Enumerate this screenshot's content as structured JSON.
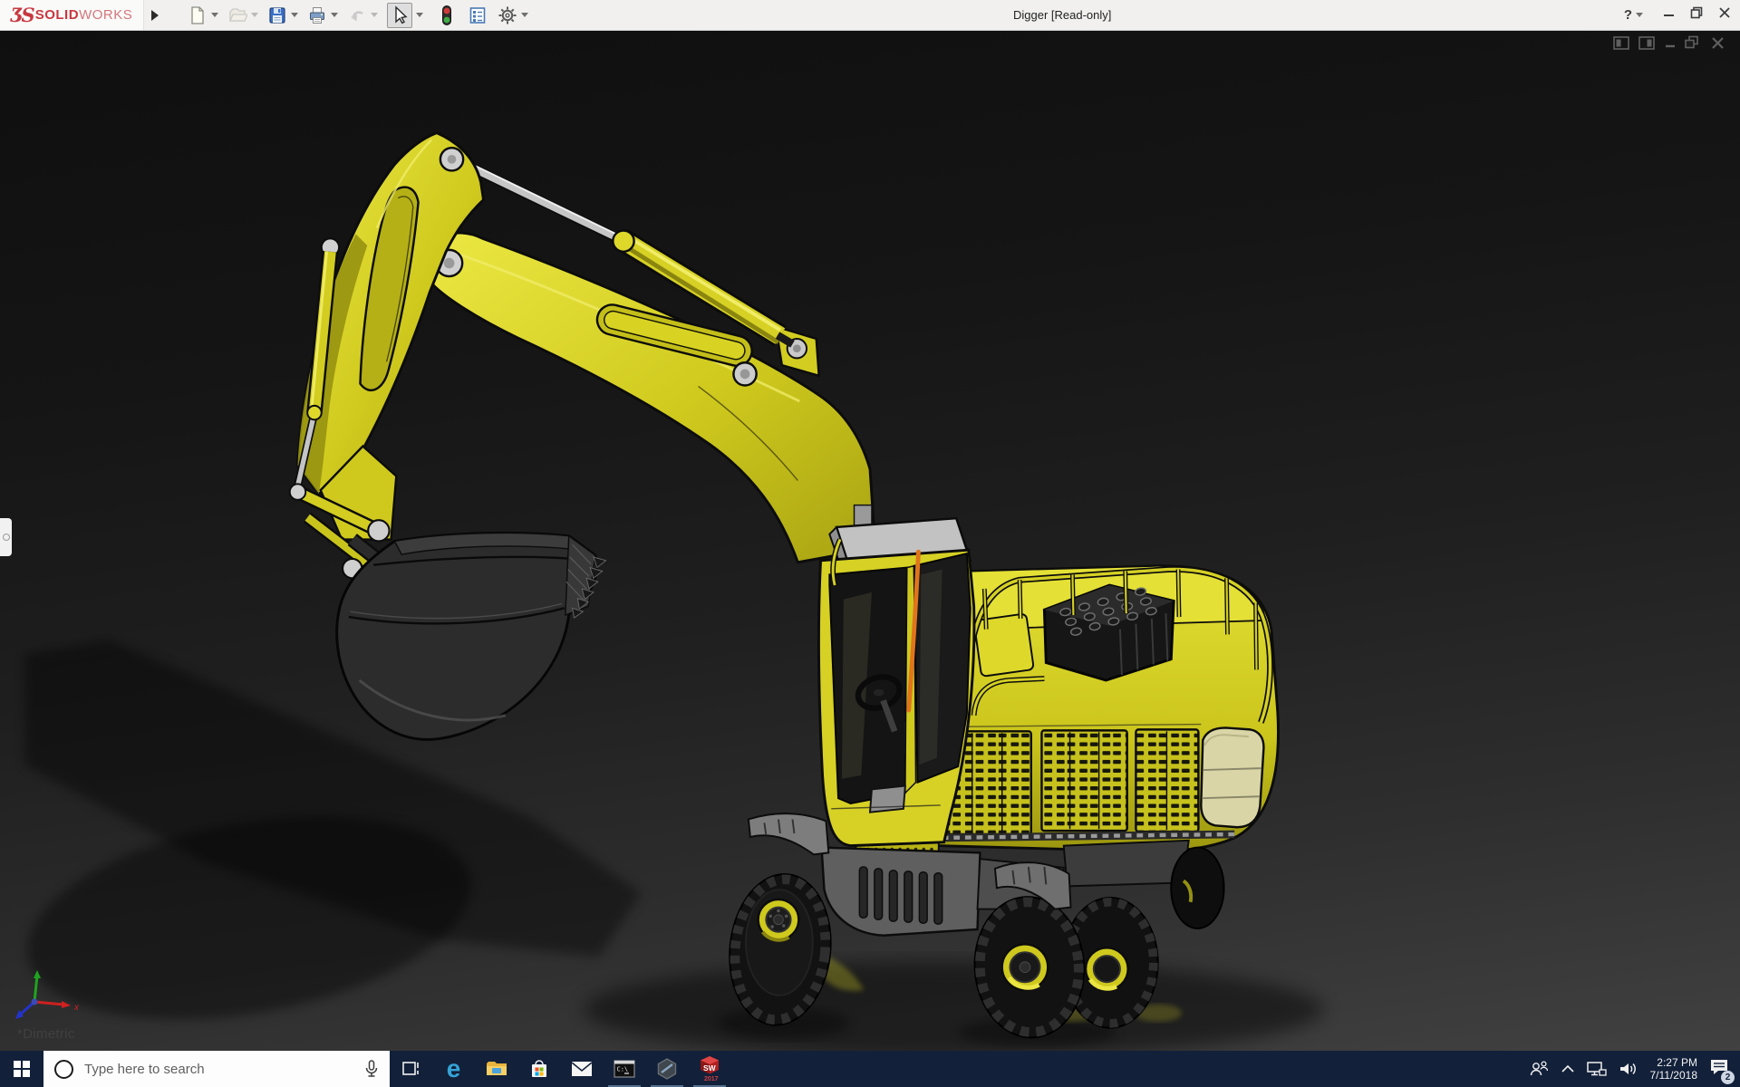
{
  "titlebar": {
    "logo": {
      "glyph": "ƷS",
      "solid": "SOLID",
      "works": "WORKS"
    },
    "title": "Digger [Read-only]",
    "help_glyph": "?",
    "tools": [
      {
        "name": "new-document",
        "enabled": true
      },
      {
        "name": "open",
        "enabled": false
      },
      {
        "name": "save",
        "enabled": true
      },
      {
        "name": "print",
        "enabled": true
      },
      {
        "name": "undo",
        "enabled": false
      },
      {
        "name": "select",
        "enabled": true,
        "active": true
      },
      {
        "name": "rebuild-traffic-light",
        "enabled": true
      },
      {
        "name": "file-properties",
        "enabled": true
      },
      {
        "name": "options",
        "enabled": true
      }
    ],
    "window_controls": [
      "minimize",
      "restore",
      "close"
    ]
  },
  "viewport": {
    "window_controls": [
      "feature-pane-left",
      "feature-pane-right",
      "minimize",
      "restore",
      "close"
    ],
    "view_label": "*Dimetric",
    "triad": {
      "x_label": "x"
    },
    "model": {
      "name": "Digger",
      "body_yellow": "#d2cd20",
      "bright_yellow": "#e9e63e",
      "shade_yellow": "#97920f",
      "wiper_orange": "#e0751c",
      "metal_silver": "#c6c6c6",
      "bucket_dark": "#2c2c2c",
      "tire_black": "#121212"
    }
  },
  "taskbar": {
    "background": "#12203a",
    "search": {
      "placeholder": "Type here to search"
    },
    "apps": [
      {
        "name": "task-view",
        "running": false
      },
      {
        "name": "edge",
        "glyph": "e",
        "running": false
      },
      {
        "name": "file-explorer",
        "running": false
      },
      {
        "name": "store",
        "running": false
      },
      {
        "name": "mail",
        "running": false
      },
      {
        "name": "command-prompt",
        "label": "C:\\",
        "running": true
      },
      {
        "name": "hex-app",
        "running": true
      },
      {
        "name": "solidworks-2017",
        "label": "SW",
        "sublabel": "2017",
        "running": true
      }
    ],
    "tray": {
      "time": "2:27 PM",
      "date": "7/11/2018",
      "notification_count": "2"
    }
  }
}
